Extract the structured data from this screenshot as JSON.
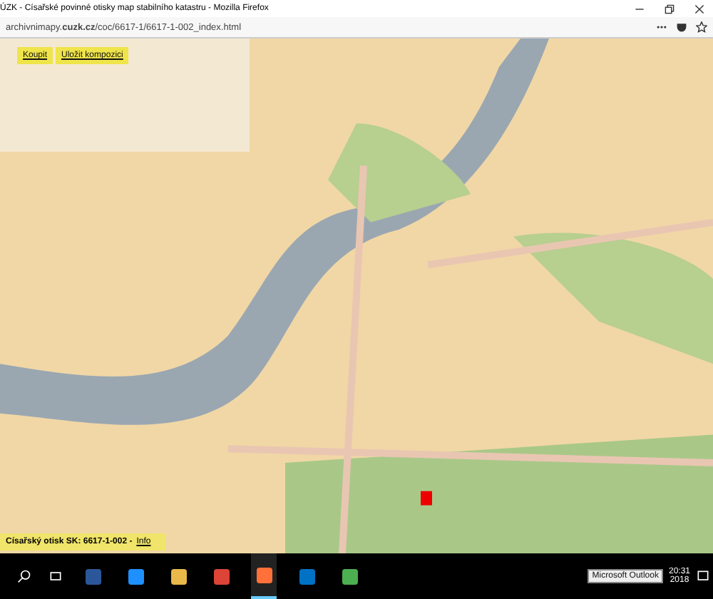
{
  "window": {
    "title": "ÚZK - Císařské povinné otisky map stabilního katastru - Mozilla Firefox"
  },
  "address_bar": {
    "url_prefix": "archivnimapy.",
    "url_domain": "cuzk.cz",
    "url_path": "/coc/6617-1/6617-1-002_index.html"
  },
  "map_toolbar": {
    "buttons": [
      "Koupit",
      "Uložit kompozici"
    ]
  },
  "info_bar": {
    "label": "Císařský otisk",
    "sheet": "SK: 6617-1-002 -",
    "link": "Info"
  },
  "taskbar": {
    "apps": [
      {
        "kind": "word",
        "active": false
      },
      {
        "kind": "edge",
        "active": false
      },
      {
        "kind": "files",
        "active": false
      },
      {
        "kind": "chrome",
        "active": false
      },
      {
        "kind": "firefox",
        "active": true
      },
      {
        "kind": "outlook",
        "active": false
      },
      {
        "kind": "viewer",
        "active": false
      }
    ],
    "tooltip": "Microsoft Outlook",
    "time": "20:31",
    "date": "2018"
  }
}
